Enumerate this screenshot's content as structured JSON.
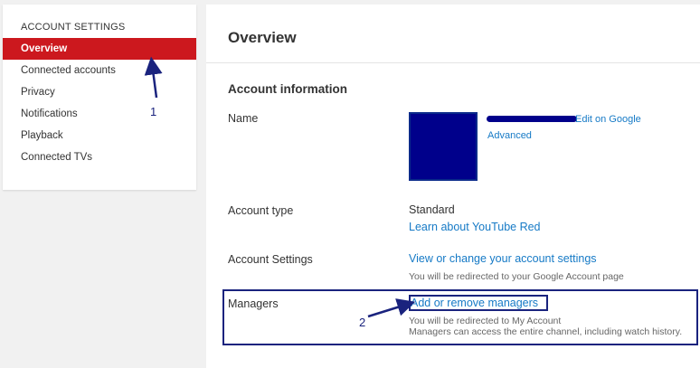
{
  "sidebar": {
    "heading": "ACCOUNT SETTINGS",
    "items": [
      {
        "label": "Overview",
        "active": true
      },
      {
        "label": "Connected accounts"
      },
      {
        "label": "Privacy"
      },
      {
        "label": "Notifications"
      },
      {
        "label": "Playback"
      },
      {
        "label": "Connected TVs"
      }
    ]
  },
  "main": {
    "title": "Overview",
    "section_title": "Account information",
    "name": {
      "label": "Name",
      "edit_link": "Edit on Google",
      "advanced_link": "Advanced"
    },
    "account_type": {
      "label": "Account type",
      "value": "Standard",
      "link": "Learn about YouTube Red"
    },
    "account_settings": {
      "label": "Account Settings",
      "link": "View or change your account settings",
      "note": "You will be redirected to your Google Account page"
    },
    "managers": {
      "label": "Managers",
      "link": "Add or remove managers",
      "note1": "You will be redirected to My Account",
      "note2": "Managers can access the entire channel, including watch history."
    }
  },
  "annotations": {
    "marker1": "1",
    "marker2": "2",
    "color": "#1a237e"
  },
  "colors": {
    "accent": "#cc181e",
    "link": "#167ac6"
  }
}
